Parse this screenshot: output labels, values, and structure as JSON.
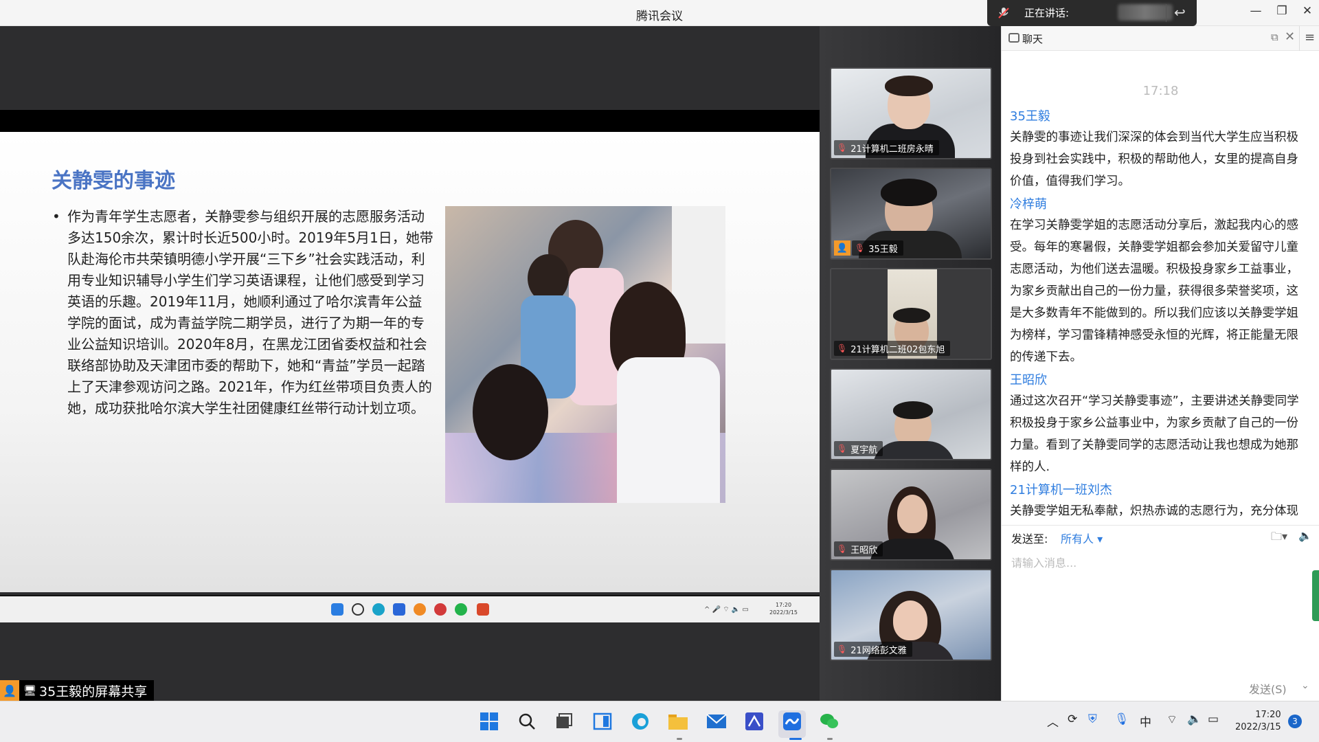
{
  "window": {
    "title": "腾讯会议"
  },
  "speaking": {
    "label": "正在讲话:"
  },
  "slide": {
    "title": "关静雯的事迹",
    "bullet": "•",
    "body": "作为青年学生志愿者，关静雯参与组织开展的志愿服务活动多达150余次，累计时长近500小时。2019年5月1日，她带队赴海伦市共荣镇明德小学开展“三下乡”社会实践活动，利用专业知识辅导小学生们学习英语课程，让他们感受到学习英语的乐趣。2019年11月，她顺利通过了哈尔滨青年公益学院的面试，成为青益学院二期学员，进行了为期一年的专业公益知识培训。2020年8月，在黑龙江团省委权益和社会联络部协助及天津团市委的帮助下，她和“青益”学员一起踏上了天津参观访问之路。2021年，作为红丝带项目负责人的她，成功获批哈尔滨大学生社团健康红丝带行动计划立项。"
  },
  "inner_taskbar": {
    "time": "17:20",
    "date": "2022/3/15"
  },
  "share_label": "35王毅的屏幕共享",
  "participants": [
    {
      "name": "21计算机二班房永晴"
    },
    {
      "name": "35王毅"
    },
    {
      "name": "21计算机二班02包东旭"
    },
    {
      "name": "夏宇航"
    },
    {
      "name": "王昭欣"
    },
    {
      "name": "21网络彭文雅"
    }
  ],
  "chat": {
    "title": "聊天",
    "time": "17:18",
    "messages": [
      {
        "sender": "35王毅",
        "text": "关静雯的事迹让我们深深的体会到当代大学生应当积极投身到社会实践中，积极的帮助他人，女里的提高自身价值，值得我们学习。"
      },
      {
        "sender": "冷梓萌",
        "text": "在学习关静雯学姐的志愿活动分享后，激起我内心的感受。每年的寒暑假，关静雯学姐都会参加关爱留守儿童志愿活动，为他们送去温暖。积极投身家乡工益事业，为家乡贡献出自己的一份力量，获得很多荣誉奖项，这是大多数青年不能做到的。所以我们应该以关静雯学姐为榜样，学习雷锋精神感受永恒的光辉，将正能量无限的传递下去。"
      },
      {
        "sender": "王昭欣",
        "text": "通过这次召开“学习关静雯事迹”，主要讲述关静雯同学积极投身于家乡公益事业中，为家乡贡献了自己的一份力量。看到了关静雯同学的志愿活动让我也想成为她那样的人."
      },
      {
        "sender": "21计算机一班刘杰",
        "text": "关静雯学姐无私奉献，炽热赤诚的志愿行为，充分体现了..."
      }
    ],
    "send_to_label": "发送至:",
    "send_to_value": "所有人 ▾",
    "input_placeholder": "请输入消息...",
    "send_button": "发送(S)"
  },
  "taskbar": {
    "time": "17:20",
    "date": "2022/3/15",
    "ime": "中",
    "notifications": "3"
  }
}
